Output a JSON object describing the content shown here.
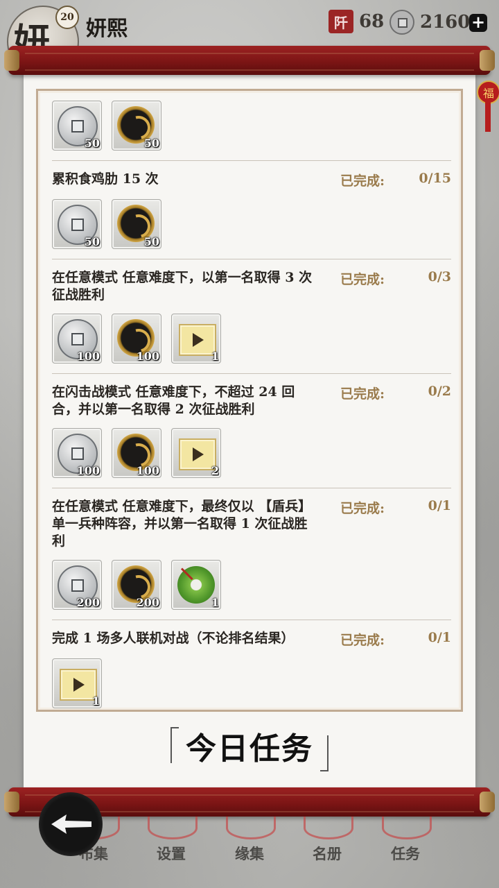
{
  "player": {
    "name": "妍熙",
    "level": "20",
    "avatar_glyph": "妍"
  },
  "resources": {
    "a": {
      "icon": "tower-icon",
      "icon_glyph": "阡",
      "value": "68"
    },
    "b": {
      "icon": "coin-icon",
      "value": "2160"
    }
  },
  "charm_glyph": "福",
  "tasks": [
    {
      "title": "",
      "status_label": "",
      "progress": "",
      "rewards": [
        {
          "type": "silver-coin",
          "count": "50"
        },
        {
          "type": "gold-coin",
          "count": "50"
        }
      ]
    },
    {
      "title": "累积食鸡肋 15 次",
      "status_label": "已完成:",
      "progress": "0/15",
      "rewards": [
        {
          "type": "silver-coin",
          "count": "50"
        },
        {
          "type": "gold-coin",
          "count": "50"
        }
      ]
    },
    {
      "title": "在任意模式 任意难度下，以第一名取得 3 次征战胜利",
      "status_label": "已完成:",
      "progress": "0/3",
      "rewards": [
        {
          "type": "silver-coin",
          "count": "100"
        },
        {
          "type": "gold-coin",
          "count": "100"
        },
        {
          "type": "ticket",
          "count": "1"
        }
      ]
    },
    {
      "title": "在闪击战模式 任意难度下，不超过 24 回合，并以第一名取得 2 次征战胜利",
      "status_label": "已完成:",
      "progress": "0/2",
      "rewards": [
        {
          "type": "silver-coin",
          "count": "100"
        },
        {
          "type": "gold-coin",
          "count": "100"
        },
        {
          "type": "ticket",
          "count": "2"
        }
      ]
    },
    {
      "title": "在任意模式 任意难度下，最终仅以 【盾兵】 单一兵种阵容，并以第一名取得 1 次征战胜利",
      "status_label": "已完成:",
      "progress": "0/1",
      "rewards": [
        {
          "type": "silver-coin",
          "count": "200"
        },
        {
          "type": "gold-coin",
          "count": "200"
        },
        {
          "type": "jade",
          "count": "1"
        }
      ]
    },
    {
      "title": "完成 1 场多人联机对战（不论排名结果）",
      "status_label": "已完成:",
      "progress": "0/1",
      "rewards": [
        {
          "type": "ticket",
          "count": "1"
        }
      ]
    }
  ],
  "daily_title": "今日任务",
  "nav": {
    "items": [
      "布集",
      "设置",
      "缘集",
      "名册",
      "任务"
    ]
  }
}
